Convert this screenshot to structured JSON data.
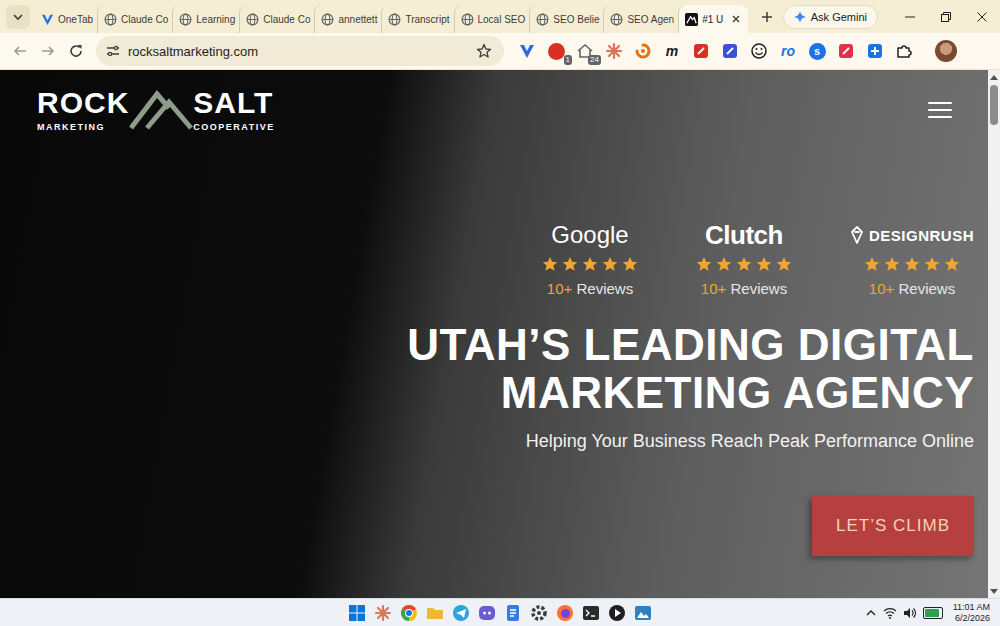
{
  "browser": {
    "tabs": [
      {
        "label": "OneTab",
        "kind": "onetab",
        "selected": false
      },
      {
        "label": "Claude Co",
        "kind": "globe",
        "selected": false
      },
      {
        "label": "Learning",
        "kind": "globe",
        "selected": false
      },
      {
        "label": "Claude Co",
        "kind": "globe",
        "selected": false
      },
      {
        "label": "annettett",
        "kind": "globe",
        "selected": false
      },
      {
        "label": "Transcript",
        "kind": "globe",
        "selected": false
      },
      {
        "label": "Local SEO",
        "kind": "globe",
        "selected": false
      },
      {
        "label": "SEO Belie",
        "kind": "globe",
        "selected": false
      },
      {
        "label": "SEO Agen",
        "kind": "globe",
        "selected": false
      },
      {
        "label": "#1 U",
        "kind": "brand",
        "selected": true
      }
    ],
    "gemini": {
      "label": "Ask Gemini"
    },
    "address": {
      "url": "rocksaltmarketing.com",
      "bookmarked": false
    },
    "extensions": [
      {
        "kind": "chevron",
        "color": "#2d6cdf"
      },
      {
        "kind": "circle",
        "color": "#d93025",
        "badge": "1"
      },
      {
        "kind": "house",
        "color": "#5f6368",
        "badge": "24"
      },
      {
        "kind": "burst",
        "color": "#d97757"
      },
      {
        "kind": "swirl",
        "color": "#e8710a"
      },
      {
        "kind": "letter",
        "color": "#202124",
        "text": "m"
      },
      {
        "kind": "square",
        "color": "#d93025"
      },
      {
        "kind": "square",
        "color": "#3c4fd6"
      },
      {
        "kind": "smile",
        "color": "#202124"
      },
      {
        "kind": "letter",
        "color": "#1a73e8",
        "text": "ro"
      },
      {
        "kind": "circle",
        "color": "#1a73e8",
        "text": "s"
      },
      {
        "kind": "square",
        "color": "#e0334b"
      },
      {
        "kind": "plus",
        "color": "#1a73e8"
      },
      {
        "kind": "puzzle",
        "color": "#202124"
      }
    ]
  },
  "page": {
    "logo": {
      "top_left": "ROCK",
      "top_right": "SALT",
      "bottom_left": "MARKETING",
      "bottom_right": "COOPERATIVE"
    },
    "reviews": [
      {
        "platform": "Google",
        "kind": "google",
        "stars": 5,
        "count": "10+",
        "label": "Reviews"
      },
      {
        "platform": "Clutch",
        "kind": "clutch",
        "stars": 5,
        "count": "10+",
        "label": "Reviews"
      },
      {
        "platform": "DESIGNRUSH",
        "kind": "designrush",
        "stars": 5,
        "count": "10+",
        "label": "Reviews"
      }
    ],
    "headline": [
      "UTAH’S LEADING DIGITAL",
      "MARKETING AGENCY"
    ],
    "subtitle": "Helping Your Business Reach Peak Performance Online",
    "cta": "LET’S CLIMB"
  },
  "taskbar": {
    "apps": [
      {
        "kind": "windows",
        "color": "#0a74da"
      },
      {
        "kind": "burst",
        "color": "#d97757"
      },
      {
        "kind": "chrome",
        "color": "#1a73e8"
      },
      {
        "kind": "folder",
        "color": "#f2b732"
      },
      {
        "kind": "telegram",
        "color": "#2aa3df"
      },
      {
        "kind": "chat",
        "color": "#6b5cd6"
      },
      {
        "kind": "notepad",
        "color": "#3b7ddd"
      },
      {
        "kind": "gear",
        "color": "#3c3c3c"
      },
      {
        "kind": "firefox",
        "color": "#ff7139"
      },
      {
        "kind": "terminal",
        "color": "#2b2b2b"
      },
      {
        "kind": "media",
        "color": "#1f1f1f"
      },
      {
        "kind": "photos",
        "color": "#2f7fc1"
      }
    ],
    "battery": {
      "level": 0.9
    },
    "time": "11:01 AM",
    "date": "6/2/2026"
  }
}
